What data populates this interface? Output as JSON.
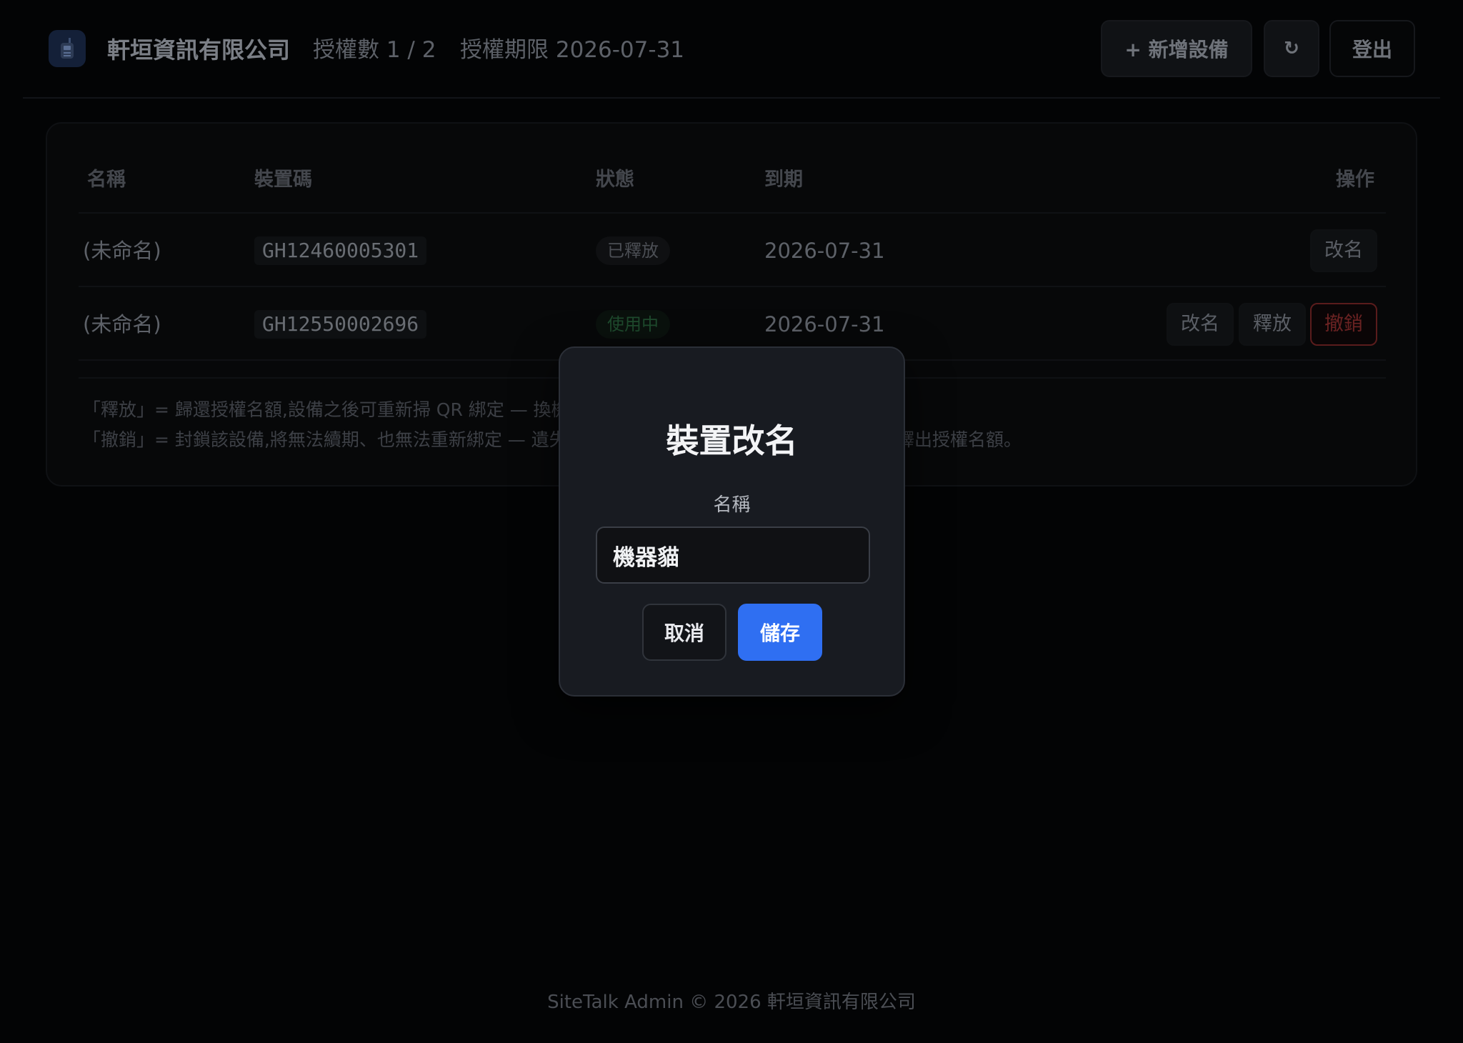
{
  "header": {
    "company": "軒垣資訊有限公司",
    "license_count": "授權數 1 / 2",
    "license_expiry": "授權期限 2026-07-31",
    "add_device_label": "+ 新增設備",
    "refresh_label": "↻",
    "logout_label": "登出"
  },
  "table": {
    "columns": [
      "名稱",
      "裝置碼",
      "狀態",
      "到期",
      "操作"
    ],
    "rows": [
      {
        "name": "(未命名)",
        "code": "GH12460005301",
        "status": "已釋放",
        "expiry": "2026-07-31",
        "actions": [
          "改名"
        ]
      },
      {
        "name": "(未命名)",
        "code": "GH12550002696",
        "status": "使用中",
        "expiry": "2026-07-31",
        "actions": [
          "改名",
          "釋放",
          "撤銷"
        ]
      }
    ]
  },
  "notes": {
    "release_visible": "「釋放」= 歸還授權名額,設備之後可重新掃 QR 綁定 — 換機",
    "revoke_visible_left": "「撤銷」= 封鎖該設備,將無法續期、也無法重新綁定 — 遺失",
    "revoke_visible_right": "釋出授權名額。"
  },
  "modal": {
    "title": "裝置改名",
    "field_label": "名稱",
    "name_value": "機器貓",
    "cancel_label": "取消",
    "save_label": "儲存"
  },
  "footer": {
    "text": "SiteTalk Admin © 2026 軒垣資訊有限公司"
  },
  "colors": {
    "background": "#030405",
    "modal_bg": "#181b21",
    "accent": "#2f6ff2",
    "active_status": "#1e4a2d",
    "revoke": "#6a2222"
  },
  "icons": {
    "logo": "walkie-talkie-icon"
  }
}
